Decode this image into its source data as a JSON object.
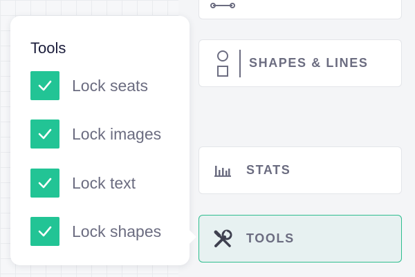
{
  "popover": {
    "title": "Tools",
    "options": [
      {
        "label": "Lock seats",
        "checked": true
      },
      {
        "label": "Lock images",
        "checked": true
      },
      {
        "label": "Lock text",
        "checked": true
      },
      {
        "label": "Lock shapes",
        "checked": true
      }
    ]
  },
  "sidebar": {
    "shapes_label": "SHAPES & LINES",
    "stats_label": "STATS",
    "tools_label": "TOOLS"
  },
  "colors": {
    "accent": "#22c495",
    "active_border": "#2dbd8e",
    "active_bg": "#e7f1f1",
    "label_text": "#6b6c80"
  },
  "icons": {
    "top": "seat-row-icon",
    "shapes": "shapes-icon",
    "stats": "bar-chart-icon",
    "tools": "wrench-screwdriver-icon",
    "check": "check-icon"
  }
}
